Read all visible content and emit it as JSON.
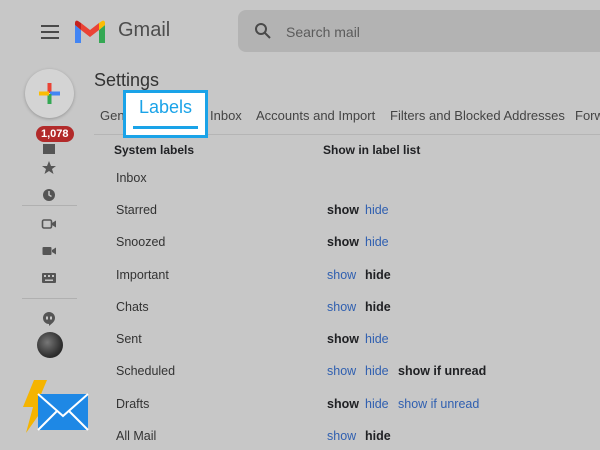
{
  "header": {
    "app_name": "Gmail",
    "search_placeholder": "Search mail"
  },
  "rail": {
    "unread_badge": "1,078"
  },
  "settings": {
    "title": "Settings",
    "tabs": [
      "Gen",
      "Inbox",
      "Accounts and Import",
      "Filters and Blocked Addresses",
      "Forw"
    ],
    "highlight_label": "Labels"
  },
  "table": {
    "col_system_labels": "System labels",
    "col_show_in_list": "Show in label list",
    "rows": [
      {
        "name": "Inbox",
        "options": []
      },
      {
        "name": "Starred",
        "options": [
          {
            "text": "show",
            "active": true
          },
          {
            "text": "hide",
            "active": false
          }
        ]
      },
      {
        "name": "Snoozed",
        "options": [
          {
            "text": "show",
            "active": true
          },
          {
            "text": "hide",
            "active": false
          }
        ]
      },
      {
        "name": "Important",
        "options": [
          {
            "text": "show",
            "active": false
          },
          {
            "text": "hide",
            "active": true
          }
        ]
      },
      {
        "name": "Chats",
        "options": [
          {
            "text": "show",
            "active": false
          },
          {
            "text": "hide",
            "active": true
          }
        ]
      },
      {
        "name": "Sent",
        "options": [
          {
            "text": "show",
            "active": true
          },
          {
            "text": "hide",
            "active": false
          }
        ]
      },
      {
        "name": "Scheduled",
        "options": [
          {
            "text": "show",
            "active": false
          },
          {
            "text": "hide",
            "active": false
          },
          {
            "text": "show if unread",
            "active": true
          }
        ]
      },
      {
        "name": "Drafts",
        "options": [
          {
            "text": "show",
            "active": true
          },
          {
            "text": "hide",
            "active": false
          },
          {
            "text": "show if unread",
            "active": false
          }
        ]
      },
      {
        "name": "All Mail",
        "options": [
          {
            "text": "show",
            "active": false
          },
          {
            "text": "hide",
            "active": true
          }
        ]
      }
    ]
  },
  "colors": {
    "background": "#c7c7c7",
    "link": "#2f5fb0",
    "highlight": "#1aa3e8",
    "badge": "#b22a2a"
  }
}
